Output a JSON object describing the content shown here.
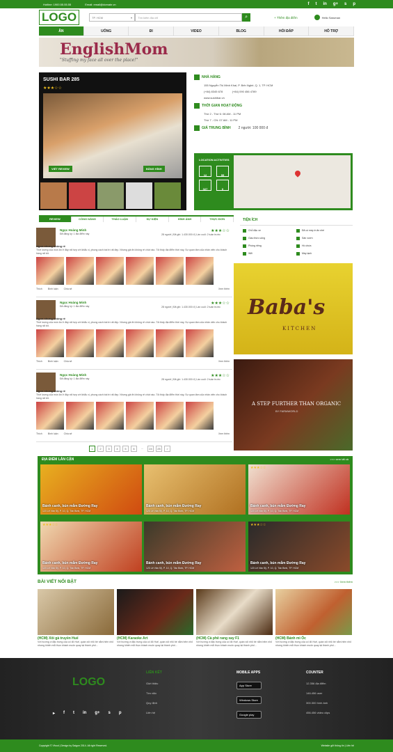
{
  "topbar": {
    "hotline": "Hotline: 1900.55.55.55",
    "email": "Email: email@domain.vn",
    "social": [
      "f",
      "t",
      "in",
      "g+",
      "s",
      "p"
    ]
  },
  "header": {
    "logo": "LOGO",
    "city": "TP. HCM",
    "search_placeholder": "Tìm kiếm địa chỉ",
    "add_place": "+ Thêm địa điểm",
    "user": "Hello Saruman"
  },
  "nav": [
    "ĂN",
    "UỐNG",
    "ĐI",
    "VIDEO",
    "BLOG",
    "HỎI ĐÁP",
    "HỖ TRỢ"
  ],
  "banner": {
    "title": "EnglishMom",
    "sub": "\"Stuffing my face all over the place!\""
  },
  "place": {
    "name": "SUSHI BAR 285",
    "rating": "★★★☆☆",
    "btn_video": "VIẾT REVIEW",
    "btn_photo": "ĐĂNG HÌNH"
  },
  "info": {
    "h1": "NHÀ HÀNG",
    "addr": "155 Nguyễn Thị Minh Khai, P. Bến Nghé, Q. 1, TP. HCM",
    "phone1": "(+84) 8345 678",
    "phone2": "(+84) 090 456 4789",
    "web": "www.sushibar.vn",
    "h2": "THỜI GIAN HOẠT ĐỘNG",
    "t1": "Thứ 2 - Thứ 6: 08 AM - 11 PM",
    "t2": "Thứ 7 - CN: 07 AM - 11 PM",
    "h3": "GIÁ TRUNG BÌNH",
    "price": "2 người: 100 000 đ",
    "loc_title": "LOCATION ACTIVITIES",
    "acts": [
      "12",
      "55",
      "327",
      "0"
    ]
  },
  "tabs": [
    "REVIEW",
    "CÔNG NĂNG",
    "THẢO LUẬN",
    "SỰ KIỆN",
    "HÌNH ẢNH",
    "THỰC ĐƠN"
  ],
  "reviews": [
    {
      "name": "Ngọc Hoàng Minh",
      "meta": "Đã đăng ký: 1 đia điểm này",
      "date": "28 người | Đã ghi: 1.430.000 đ | Lần cuối: 2 tuần trước",
      "title": "Ngon nhưng không rẻ",
      "text": "Thời lượng của món ăn ở đây rất hợp với khẩu vị, phong cách bài trí rất đẹp. Nhưng giá thì không rẻ chút nào. Tôi thấy địa điểm thời này, Sự quan tâm của nhân viên cho khách hàng rất tốt.",
      "like": "Thích",
      "cmt": "Bình luận",
      "share": "Chia sẻ",
      "more": "Xem thêm"
    },
    {
      "name": "Ngọc Hoàng Minh",
      "meta": "Đã đăng ký: 1 đia điểm này",
      "date": "28 người | Đã ghi: 1.430.000 đ | Lần cuối: 2 tuần trước",
      "title": "Ngon nhưng không rẻ",
      "text": "Thời lượng của món ăn ở đây rất hợp với khẩu vị, phong cách bài trí rất đẹp. Nhưng giá thì không rẻ chút nào. Tôi thấy địa điểm thời này, Sự quan tâm của nhân viên cho khách hàng rất tốt.",
      "like": "Thích",
      "cmt": "Bình luận",
      "share": "Chia sẻ",
      "more": "Xem thêm"
    },
    {
      "name": "Ngọc Hoàng Minh",
      "meta": "Đã đăng ký: 1 đia điểm này",
      "date": "28 người | Đã ghi: 1.430.000 đ | Lần cuối: 2 tuần trước",
      "title": "Ngon nhưng không rẻ",
      "text": "Thời lượng của món ăn ở đây rất hợp với khẩu vị, phong cách bài trí rất đẹp. Nhưng giá thì không rẻ chút nào. Tôi thấy địa điểm thời này, Sự quan tâm của nhân viên cho khách hàng rất tốt.",
      "like": "Thích",
      "cmt": "Bình luận",
      "share": "Chia sẻ",
      "more": "Xem thêm"
    }
  ],
  "pager": [
    "1",
    "2",
    "3",
    "4",
    "5",
    "6",
    "...",
    "24",
    "25",
    ">"
  ],
  "utilities": {
    "title": "TIỆN ÍCH",
    "items": [
      "Chỗ đậu xe",
      "Đã có máy in ăn nhé",
      "Giao thức uống",
      "Sân vườn",
      "Phòng riêng",
      "Hồ chứa",
      "Wifi",
      "Máy lạnh"
    ]
  },
  "ads": {
    "a1": "Baba's",
    "a1k": "KITCHEN",
    "a2": "A STEP FURTHER THAN ORGANIC",
    "a2s": "BY FARMWORLD"
  },
  "nearby": {
    "title": "ĐỊA ĐIỂM LÂN CẬN",
    "more": ">>> xem tất cả",
    "name": "Bánh canh, bún mắm Đường Ray",
    "addr": "123 Lê Văn Sỹ, P. 10, Q. Tân Bình, TP. HCM",
    "stars": "★★★☆☆"
  },
  "featured": {
    "title": "BÀI VIẾT NỔI BẬT",
    "more": ">>> Xem thêm",
    "items": [
      {
        "t": "(HCM) Xôi gà truyền Huế",
        "d": "Với hương vị đặc trưng của cố đô Huế, quán xôi nhỏ bé nằm hẻm nhỏ nhưng khiến mỗi thực khách muốn quay lại thành phố..."
      },
      {
        "t": "(HCM) Karaoke Art",
        "d": "Với hương vị đặc trưng của cố đô Huế, quán xôi nhỏ bé nằm hẻm nhỏ nhưng khiến mỗi thực khách muốn quay lại thành phố..."
      },
      {
        "t": "(HCM) Cà phê rang xay F1",
        "d": "Với hương vị đặc trưng của cố đô Huế, quán xôi nhỏ bé nằm hẻm nhỏ nhưng khiến mỗi thực khách muốn quay lại thành phố..."
      },
      {
        "t": "(HCM) Bánh mì Óc",
        "d": "Với hương vị đặc trưng của cố đô Huế, quán xôi nhỏ bé nằm hẻm nhỏ nhưng khiến mỗi thực khách muốn quay lại thành phố..."
      }
    ]
  },
  "footer": {
    "logo": "LOGO",
    "links_title": "LIÊN KẾT",
    "links": [
      "Giới thiệu",
      "Tìm việc",
      "Quy định",
      "Liên hệ"
    ],
    "apps_title": "MOBILE APPS",
    "apps": [
      "App Store",
      "Windows Store",
      "Google play"
    ],
    "counter_title": "COUNTER",
    "counts": [
      "12.356 địa điểm",
      "146.456 user",
      "300.300 hình ảnh",
      "456.456 video clips"
    ]
  },
  "bottom": {
    "copy": "Copyright © Vfood | Design by Saigon 2014. All right Reserved.",
    "right": "Website gửi thông tin | Liên hệ"
  }
}
